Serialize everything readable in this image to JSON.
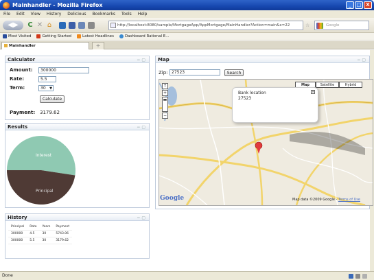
{
  "window": {
    "title": "Mainhandler - Mozilla Firefox",
    "controls": [
      "_",
      "□",
      "X"
    ]
  },
  "menu": [
    "File",
    "Edit",
    "View",
    "History",
    "Delicious",
    "Bookmarks",
    "Tools",
    "Help"
  ],
  "nav": {
    "url": "http://localhost:8080/sample/MortgageApp/AppMortgage/MainHandler?Action=main&x=22",
    "search_placeholder": "Google"
  },
  "bookmarks": [
    "Most Visited",
    "Getting Started",
    "Latest Headlines",
    "Dashboard Rational E..."
  ],
  "tab": {
    "label": "Mainhandler",
    "new": "+"
  },
  "calculator": {
    "title": "Calculator",
    "amount_label": "Amount:",
    "amount_value": "300000",
    "rate_label": "Rate:",
    "rate_value": "5.5",
    "term_label": "Term:",
    "term_value": "30",
    "button": "Calculate",
    "payment_label": "Payment:",
    "payment_value": "3179.62"
  },
  "results": {
    "title": "Results",
    "interest_label": "Interest",
    "principal_label": "Principal"
  },
  "history": {
    "title": "History",
    "headers": [
      "Principal",
      "Rate",
      "Years",
      "Payment"
    ],
    "rows": [
      [
        "300000",
        "4.5",
        "30",
        "5743.06"
      ],
      [
        "300000",
        "5.5",
        "30",
        "3179.62"
      ]
    ]
  },
  "map": {
    "title": "Map",
    "zip_label": "Zip:",
    "zip_value": "27523",
    "search_button": "Search",
    "types": [
      "Map",
      "Satellite",
      "Hybrid"
    ],
    "bubble_line1": "Bank location",
    "bubble_line2": "27523",
    "copyright": "Map data ©2009 Google - ",
    "terms": "Terms of Use",
    "logo": "Google"
  },
  "status": {
    "text": "Done"
  },
  "chart_data": {
    "type": "pie",
    "categories": [
      "Interest",
      "Principal"
    ],
    "values": [
      52.4,
      47.6
    ],
    "colors": [
      "#8fc9b2",
      "#4f3a35"
    ]
  }
}
